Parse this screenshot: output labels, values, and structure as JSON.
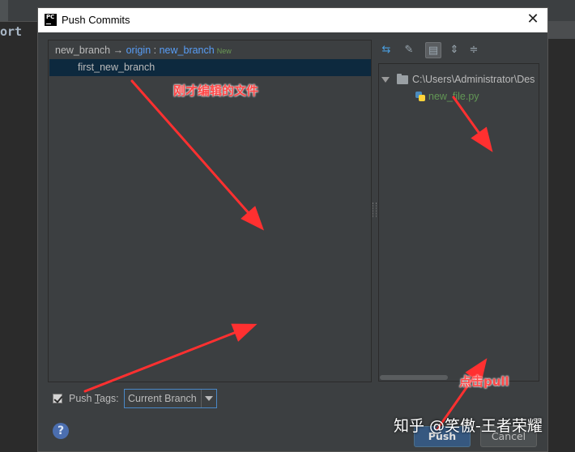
{
  "editor": {
    "code_fragment": "ort"
  },
  "dialog": {
    "title": "Push Commits",
    "logo_text": "PC",
    "close_glyph": "✕"
  },
  "push_target": {
    "local_branch": "new_branch",
    "arrow": "→",
    "remote": "origin",
    "separator": ":",
    "remote_branch": "new_branch",
    "badge": "New"
  },
  "commits": [
    {
      "message": "first_new_branch",
      "selected": true
    }
  ],
  "toolbar": {
    "icons": [
      "merge-arrows-icon",
      "edit-source-icon",
      "group-by-directory-icon",
      "expand-all-icon",
      "collapse-all-icon"
    ]
  },
  "file_tree": {
    "folder_path": "C:\\Users\\Administrator\\Des",
    "files": [
      {
        "name": "new_file.py",
        "status_color": "#629755"
      }
    ]
  },
  "push_tags": {
    "checked": true,
    "label": "Push Tags:",
    "mnemonic_label_prefix": "Push ",
    "mnemonic_letter": "T",
    "mnemonic_label_suffix": "ags:",
    "selected_option": "Current Branch"
  },
  "buttons": {
    "help": "?",
    "push": "Push",
    "cancel": "Cancel"
  },
  "annotations": {
    "edited_file_note": "刚才编辑的文件",
    "click_note": "点击pull",
    "color": "#ff3030"
  },
  "watermark": "知乎 @笑傲-王者荣耀"
}
